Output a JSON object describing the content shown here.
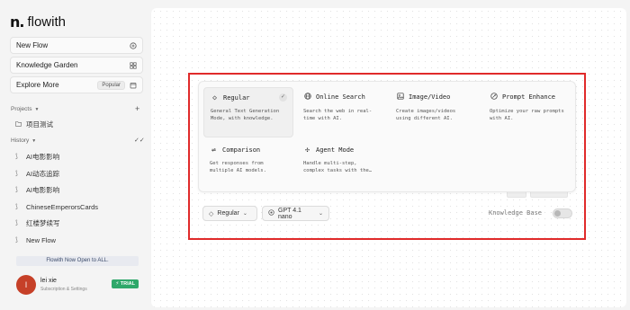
{
  "brand": {
    "mark": "n.",
    "name": "flowith"
  },
  "nav": {
    "new_flow": "New Flow",
    "knowledge_garden": "Knowledge Garden",
    "explore_more": "Explore More",
    "popular_badge": "Popular"
  },
  "projects": {
    "label": "Projects",
    "items": [
      {
        "label": "项目测试"
      }
    ]
  },
  "history": {
    "label": "History",
    "items": [
      {
        "label": "AI电影影响"
      },
      {
        "label": "AI动态追踪"
      },
      {
        "label": "AI电影影响"
      },
      {
        "label": "ChineseEmperorsCards"
      },
      {
        "label": "红楼梦续写"
      },
      {
        "label": "New Flow"
      }
    ]
  },
  "announcement": "Flowith Now Open to ALL.",
  "user": {
    "avatar_letter": "l",
    "name": "lei xie",
    "subtitle": "Subscription & Settings",
    "badge": "TRIAL"
  },
  "modes": [
    {
      "title": "Regular",
      "icon": "diamond-icon",
      "desc": "General Text Generation Mode, with knowledge.",
      "selected": true
    },
    {
      "title": "Online Search",
      "icon": "globe-icon",
      "desc": "Search the web in real-time with AI.",
      "selected": false
    },
    {
      "title": "Image/Video",
      "icon": "image-icon",
      "desc": "Create images/videos using different AI.",
      "selected": false
    },
    {
      "title": "Prompt Enhance",
      "icon": "sparkle-icon",
      "desc": "Optimize your raw prompts with AI.",
      "selected": false
    },
    {
      "title": "Comparison",
      "icon": "compare-icon",
      "desc": "Get responses from multiple AI models.",
      "selected": false
    },
    {
      "title": "Agent Mode",
      "icon": "agent-icon",
      "desc": "Handle multi-step, complex tasks with the…",
      "selected": false
    }
  ],
  "toolbar": {
    "mode_select": "Regular",
    "model_select": "GPT 4.1 nano",
    "knowledge_base_label": "Knowledge Base",
    "knowledge_base_enabled": false
  },
  "colors": {
    "highlight_border": "#e02a2a",
    "trial_badge": "#2fa86a",
    "avatar": "#c64028"
  }
}
